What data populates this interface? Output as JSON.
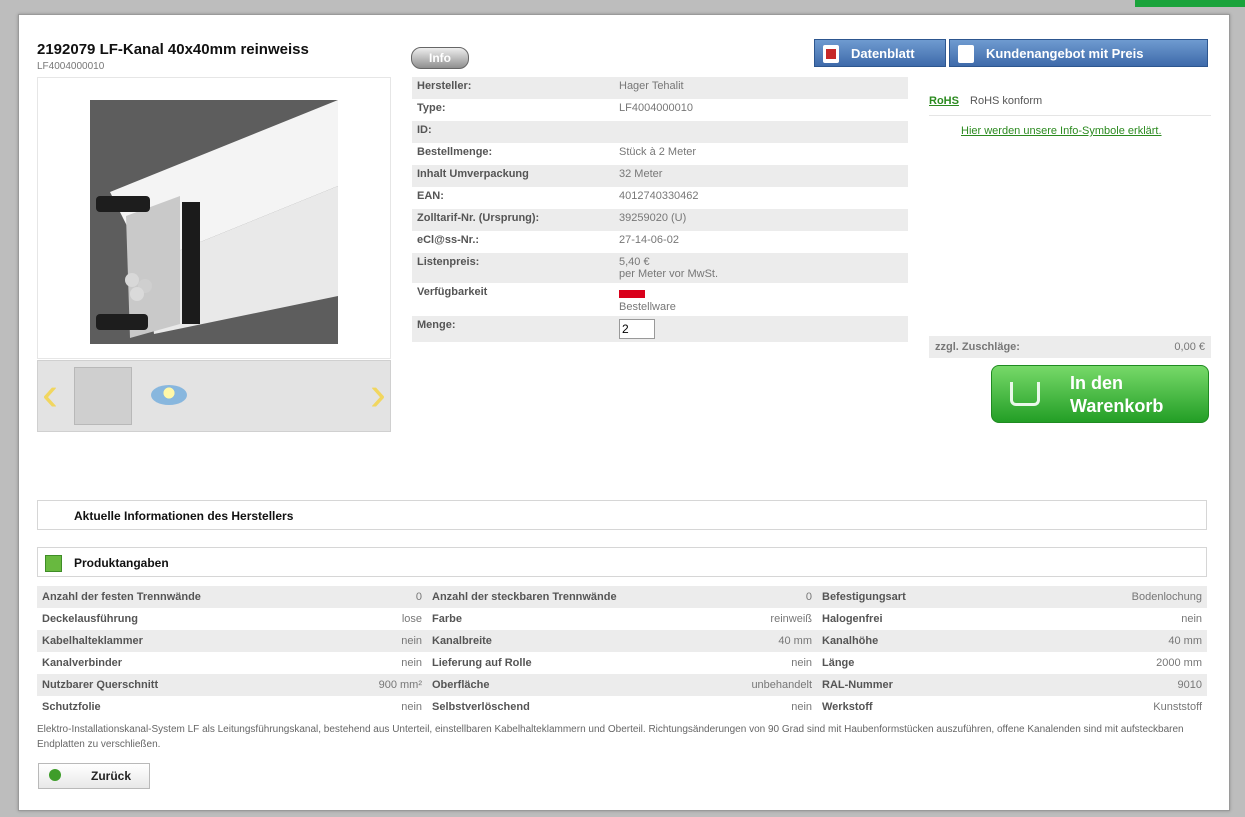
{
  "product": {
    "title": "2192079 LF-Kanal 40x40mm reinweiss",
    "article_code": "LF4004000010"
  },
  "buttons": {
    "info": "Info",
    "datasheet": "Datenblatt",
    "offer": "Kundenangebot mit Preis",
    "cart": "In den\nWarenkorb",
    "back": "Zurück"
  },
  "specs": [
    {
      "label": "Hersteller:",
      "value": "Hager Tehalit"
    },
    {
      "label": "Type:",
      "value": "LF4004000010"
    },
    {
      "label": "ID:",
      "value": ""
    },
    {
      "label": "Bestellmenge:",
      "value": "Stück à 2 Meter"
    },
    {
      "label": "Inhalt Umverpackung",
      "value": "32 Meter"
    },
    {
      "label": "EAN:",
      "value": "4012740330462"
    },
    {
      "label": "Zolltarif-Nr. (Ursprung):",
      "value": "39259020 (U)"
    },
    {
      "label": "eCl@ss-Nr.:",
      "value": "27-14-06-02"
    },
    {
      "label": "Listenpreis:",
      "value": "5,40 €",
      "note": "per Meter vor MwSt."
    },
    {
      "label": "Verfügbarkeit",
      "value": "Bestellware"
    },
    {
      "label": "Menge:",
      "value": "2"
    }
  ],
  "availability_color": "#d9001b",
  "rohs": {
    "badge": "RoHS",
    "text": "RoHS konform",
    "link": "Hier werden unsere Info-Symbole erklärt."
  },
  "charges": {
    "label": "zzgl. Zuschläge:",
    "value": "0,00 €"
  },
  "sections": {
    "manufacturer_info": "Aktuelle Informationen des Herstellers",
    "product_details": "Produktangaben"
  },
  "attributes": [
    [
      "Anzahl der festen Trennwände",
      "0",
      "Anzahl der steckbaren Trennwände",
      "0",
      "Befestigungsart",
      "Bodenlochung"
    ],
    [
      "Deckelausführung",
      "lose",
      "Farbe",
      "reinweiß",
      "Halogenfrei",
      "nein"
    ],
    [
      "Kabelhalteklammer",
      "nein",
      "Kanalbreite",
      "40 mm",
      "Kanalhöhe",
      "40 mm"
    ],
    [
      "Kanalverbinder",
      "nein",
      "Lieferung auf Rolle",
      "nein",
      "Länge",
      "2000 mm"
    ],
    [
      "Nutzbarer Querschnitt",
      "900 mm²",
      "Oberfläche",
      "unbehandelt",
      "RAL-Nummer",
      "9010"
    ],
    [
      "Schutzfolie",
      "nein",
      "Selbstverlöschend",
      "nein",
      "Werkstoff",
      "Kunststoff"
    ]
  ],
  "description": "Elektro-Installationskanal-System LF als Leitungsführungskanal, bestehend aus Unterteil, einstellbaren Kabelhalteklammern und Oberteil. Richtungsänderungen von 90 Grad sind mit Haubenformstücken auszuführen, offene Kanalenden sind mit aufsteckbaren Endplatten zu verschließen.",
  "icons": {
    "pdf": "pdf-icon",
    "document": "document-icon",
    "cart": "cart-icon",
    "back": "back-icon",
    "expand": "expand-icon"
  }
}
